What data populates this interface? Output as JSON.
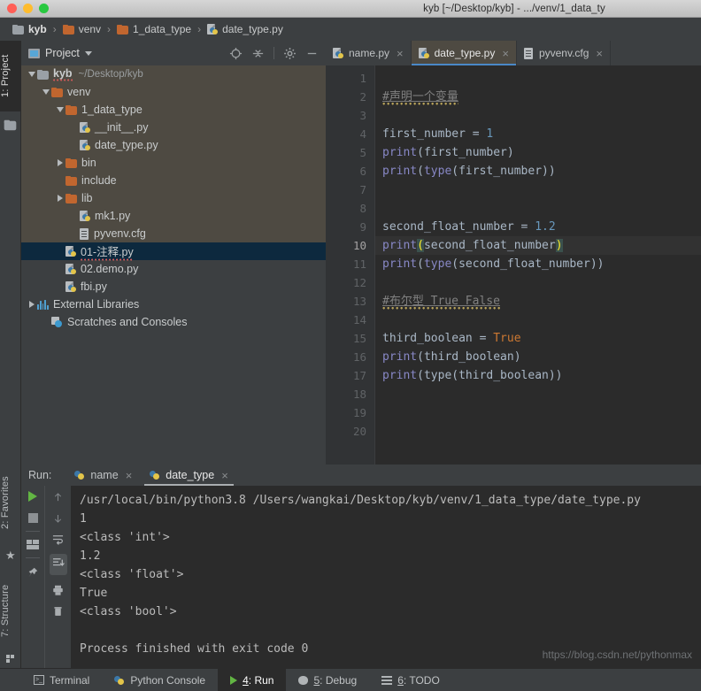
{
  "window": {
    "title": "kyb [~/Desktop/kyb] - .../venv/1_data_ty",
    "traffic": [
      "close",
      "minimize",
      "zoom"
    ]
  },
  "breadcrumb": {
    "items": [
      {
        "label": "kyb",
        "icon": "folder-grey-icon"
      },
      {
        "label": "venv",
        "icon": "folder-icon"
      },
      {
        "label": "1_data_type",
        "icon": "folder-icon"
      },
      {
        "label": "date_type.py",
        "icon": "python-file-icon"
      }
    ],
    "separator": "›"
  },
  "left_strip": {
    "tabs": [
      {
        "label": "1: Project",
        "active": true
      },
      {
        "label": "2: Favorites",
        "active": false
      },
      {
        "label": "7: Structure",
        "active": false
      }
    ]
  },
  "project_panel": {
    "title": "Project",
    "tools": [
      "locate-icon",
      "collapse-all-icon",
      "gear-icon",
      "minimize-icon"
    ],
    "tree": [
      {
        "label": "kyb",
        "sub": "~/Desktop/kyb",
        "indent": 0,
        "arrow": "down",
        "icon": "folder-grey-icon",
        "bold": true,
        "state": "inproj",
        "squiggle": true
      },
      {
        "label": "venv",
        "sub": "",
        "indent": 1,
        "arrow": "down",
        "icon": "folder-icon",
        "bold": false,
        "state": "inproj",
        "squiggle": false
      },
      {
        "label": "1_data_type",
        "sub": "",
        "indent": 2,
        "arrow": "down",
        "icon": "folder-icon",
        "bold": false,
        "state": "inproj",
        "squiggle": false
      },
      {
        "label": "__init__.py",
        "sub": "",
        "indent": 3,
        "arrow": "none",
        "icon": "python-file-icon",
        "bold": false,
        "state": "inproj",
        "squiggle": false
      },
      {
        "label": "date_type.py",
        "sub": "",
        "indent": 3,
        "arrow": "none",
        "icon": "python-file-icon",
        "bold": false,
        "state": "inproj",
        "squiggle": false
      },
      {
        "label": "bin",
        "sub": "",
        "indent": 2,
        "arrow": "right",
        "icon": "folder-icon",
        "bold": false,
        "state": "inproj",
        "squiggle": false
      },
      {
        "label": "include",
        "sub": "",
        "indent": 2,
        "arrow": "none",
        "icon": "folder-icon",
        "bold": false,
        "state": "inproj",
        "squiggle": false
      },
      {
        "label": "lib",
        "sub": "",
        "indent": 2,
        "arrow": "right",
        "icon": "folder-icon",
        "bold": false,
        "state": "inproj",
        "squiggle": false
      },
      {
        "label": "mk1.py",
        "sub": "",
        "indent": 3,
        "arrow": "none",
        "icon": "python-file-icon",
        "bold": false,
        "state": "inproj",
        "squiggle": false
      },
      {
        "label": "pyvenv.cfg",
        "sub": "",
        "indent": 3,
        "arrow": "none",
        "icon": "cfg-file-icon",
        "bold": false,
        "state": "inproj",
        "squiggle": false
      },
      {
        "label": "01-注释.py",
        "sub": "",
        "indent": 2,
        "arrow": "none",
        "icon": "python-file-icon",
        "bold": false,
        "state": "selected",
        "squiggle": true
      },
      {
        "label": "02.demo.py",
        "sub": "",
        "indent": 2,
        "arrow": "none",
        "icon": "python-file-icon",
        "bold": false,
        "state": "none",
        "squiggle": false
      },
      {
        "label": "fbi.py",
        "sub": "",
        "indent": 2,
        "arrow": "none",
        "icon": "python-file-icon",
        "bold": false,
        "state": "none",
        "squiggle": false
      },
      {
        "label": "External Libraries",
        "sub": "",
        "indent": 0,
        "arrow": "right",
        "icon": "library-icon",
        "bold": false,
        "state": "none",
        "squiggle": false
      },
      {
        "label": "Scratches and Consoles",
        "sub": "",
        "indent": 1,
        "arrow": "none",
        "icon": "scratches-icon",
        "bold": false,
        "state": "none",
        "squiggle": false
      }
    ]
  },
  "editor": {
    "tabs": [
      {
        "label": "name.py",
        "icon": "python-file-icon",
        "active": false,
        "close": "×"
      },
      {
        "label": "date_type.py",
        "icon": "python-file-icon",
        "active": true,
        "close": "×"
      },
      {
        "label": "pyvenv.cfg",
        "icon": "cfg-file-icon",
        "active": false,
        "close": "×"
      }
    ],
    "line_numbers": [
      "1",
      "2",
      "3",
      "4",
      "5",
      "6",
      "7",
      "8",
      "9",
      "10",
      "11",
      "12",
      "13",
      "14",
      "15",
      "16",
      "17",
      "18",
      "19",
      "20"
    ],
    "current_line": 10,
    "code": [
      {
        "n": 1,
        "tokens": []
      },
      {
        "n": 2,
        "tokens": [
          {
            "t": "#声明一个变量",
            "c": "cm sq"
          }
        ]
      },
      {
        "n": 3,
        "tokens": []
      },
      {
        "n": 4,
        "tokens": [
          {
            "t": "first_number = ",
            "c": "op"
          },
          {
            "t": "1",
            "c": "num"
          }
        ]
      },
      {
        "n": 5,
        "tokens": [
          {
            "t": "print",
            "c": "fn"
          },
          {
            "t": "(first_number)",
            "c": "op"
          }
        ]
      },
      {
        "n": 6,
        "tokens": [
          {
            "t": "print",
            "c": "fn"
          },
          {
            "t": "(",
            "c": "op"
          },
          {
            "t": "type",
            "c": "fn"
          },
          {
            "t": "(first_number))",
            "c": "op"
          }
        ]
      },
      {
        "n": 7,
        "tokens": []
      },
      {
        "n": 8,
        "tokens": []
      },
      {
        "n": 9,
        "tokens": [
          {
            "t": "second_float_number = ",
            "c": "op"
          },
          {
            "t": "1.2",
            "c": "num"
          }
        ]
      },
      {
        "n": 10,
        "tokens": [
          {
            "t": "print",
            "c": "fn"
          },
          {
            "t": "(",
            "c": "paren-hl"
          },
          {
            "t": "second_float_number",
            "c": "op"
          },
          {
            "t": ")",
            "c": "paren-hl"
          }
        ]
      },
      {
        "n": 11,
        "tokens": [
          {
            "t": "print",
            "c": "fn"
          },
          {
            "t": "(",
            "c": "op"
          },
          {
            "t": "type",
            "c": "fn"
          },
          {
            "t": "(second_float_number))",
            "c": "op"
          }
        ]
      },
      {
        "n": 12,
        "tokens": []
      },
      {
        "n": 13,
        "tokens": [
          {
            "t": "#布尔型 True False",
            "c": "cm sq"
          }
        ]
      },
      {
        "n": 14,
        "tokens": []
      },
      {
        "n": 15,
        "tokens": [
          {
            "t": "third_boolean = ",
            "c": "op"
          },
          {
            "t": "True",
            "c": "kw"
          }
        ]
      },
      {
        "n": 16,
        "tokens": [
          {
            "t": "print",
            "c": "fn"
          },
          {
            "t": "(third_boolean)",
            "c": "op"
          }
        ]
      },
      {
        "n": 17,
        "tokens": [
          {
            "t": "print",
            "c": "fn"
          },
          {
            "t": "(type(third_boolean))",
            "c": "op"
          }
        ]
      },
      {
        "n": 18,
        "tokens": []
      },
      {
        "n": 19,
        "tokens": []
      },
      {
        "n": 20,
        "tokens": []
      }
    ]
  },
  "run_panel": {
    "label": "Run:",
    "tabs": [
      {
        "label": "name",
        "icon": "python-run-icon",
        "active": false,
        "close": "×"
      },
      {
        "label": "date_type",
        "icon": "python-run-icon",
        "active": true,
        "close": "×"
      }
    ],
    "tools_left": [
      "run-icon",
      "stop-icon",
      "restore-layout-icon",
      "pin-icon"
    ],
    "tools_right": [
      "up-arrow-icon",
      "down-arrow-icon",
      "soft-wrap-icon",
      "scroll-to-end-icon",
      "print-icon",
      "trash-icon"
    ],
    "console_output": [
      "/usr/local/bin/python3.8 /Users/wangkai/Desktop/kyb/venv/1_data_type/date_type.py",
      "1",
      "<class 'int'>",
      "1.2",
      "<class 'float'>",
      "True",
      "<class 'bool'>",
      "",
      "Process finished with exit code 0"
    ],
    "watermark": "https://blog.csdn.net/pythonmax"
  },
  "status_bar": {
    "buttons": [
      {
        "label": "Terminal",
        "icon": "terminal-icon",
        "key": "",
        "active": false
      },
      {
        "label": "Python Console",
        "icon": "python-console-icon",
        "key": "",
        "active": false
      },
      {
        "label": "Run",
        "icon": "run-icon",
        "key": "4",
        "active": true
      },
      {
        "label": "Debug",
        "icon": "debug-icon",
        "key": "5",
        "active": false
      },
      {
        "label": "TODO",
        "icon": "todo-icon",
        "key": "6",
        "active": false
      }
    ]
  },
  "colors": {
    "panel_bg": "#3c3f41",
    "editor_bg": "#2b2b2b",
    "selection_blue": "#0d293e",
    "in_project_tan": "#4e4a42",
    "accent_tab_underline": "#4a88c7",
    "folder_orange": "#c1662f",
    "keyword_orange": "#cc7832",
    "number_blue": "#6897bb",
    "function_purple": "#8888c6",
    "run_green": "#62b543"
  }
}
